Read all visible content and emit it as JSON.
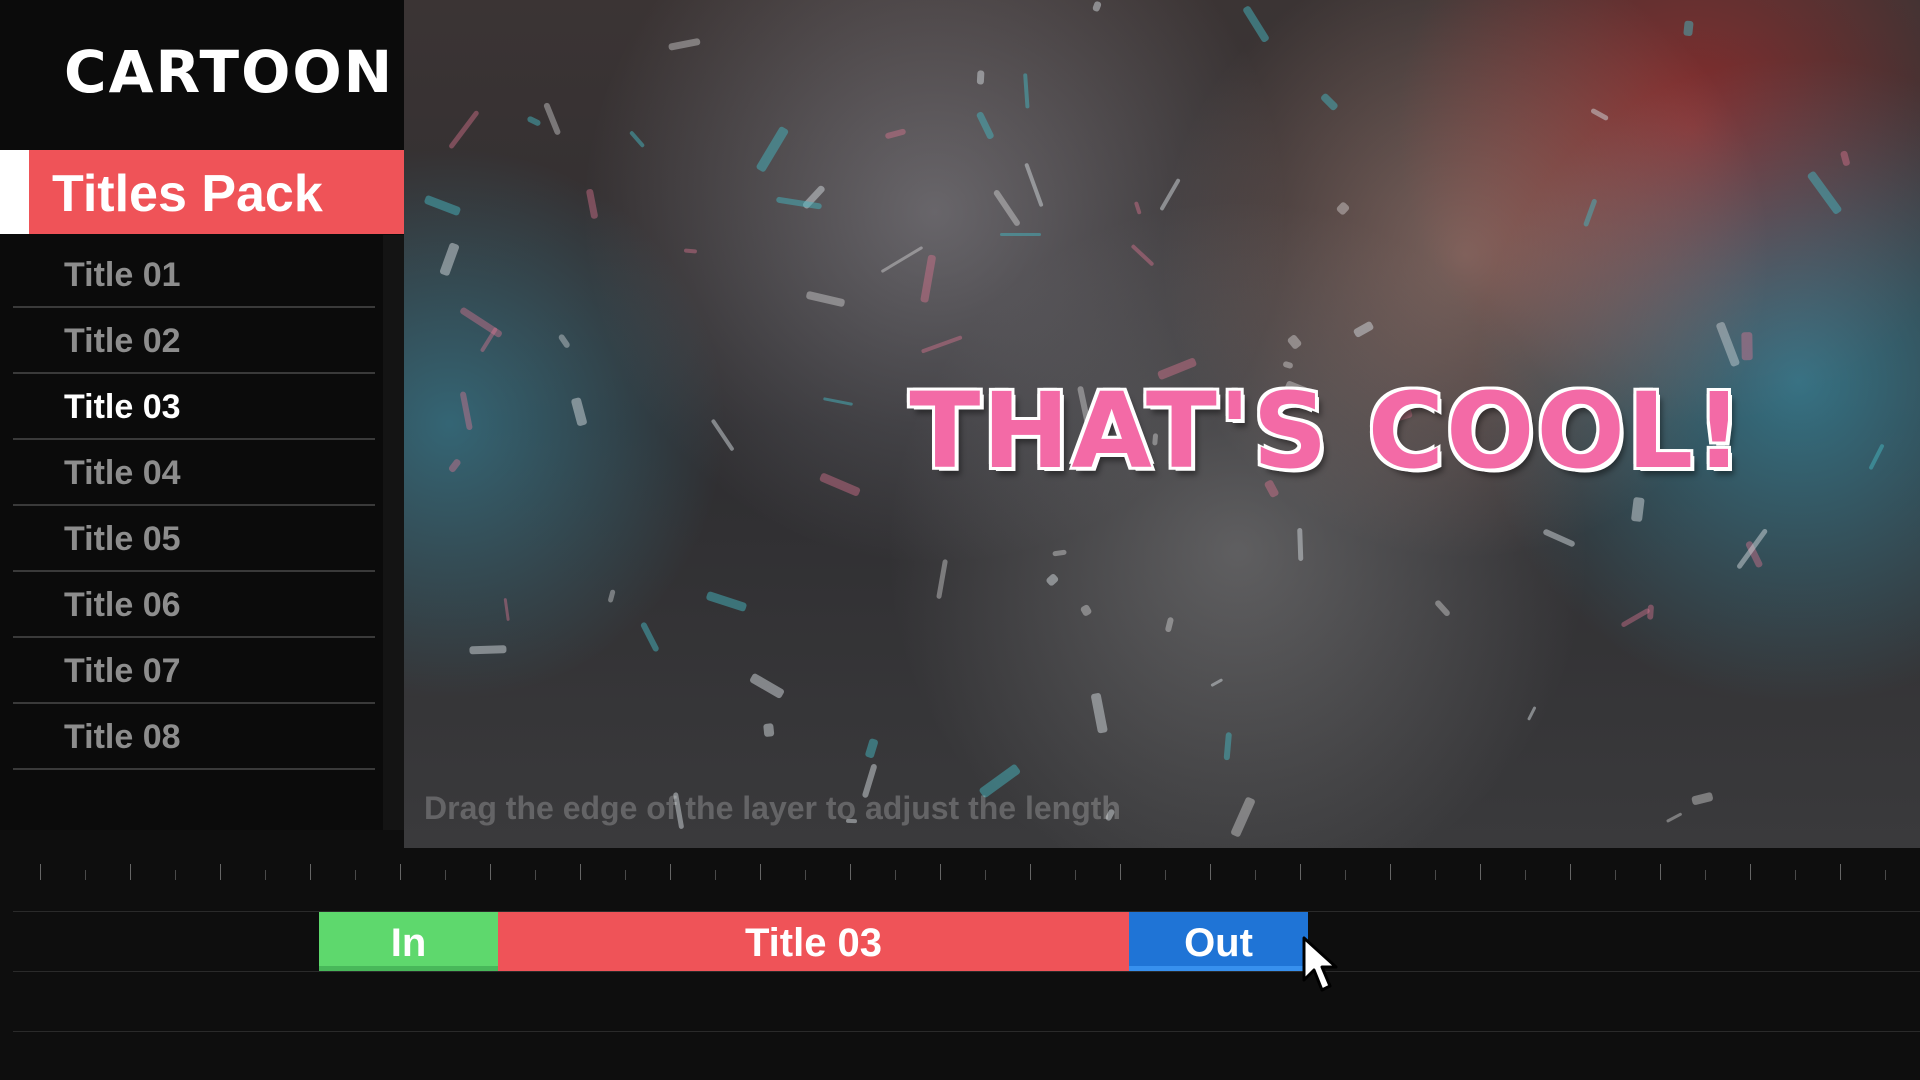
{
  "sidebar": {
    "logo": "CARTOON",
    "pack_label": "Titles Pack",
    "titles": [
      "Title 01",
      "Title 02",
      "Title 03",
      "Title 04",
      "Title 05",
      "Title 06",
      "Title 07",
      "Title 08"
    ],
    "active_index": 2
  },
  "preview": {
    "headline": "THAT'S COOL!",
    "hint": "Drag the edge of the layer to adjust the length"
  },
  "timeline": {
    "in_label": "In",
    "main_label": "Title 03",
    "out_label": "Out"
  },
  "colors": {
    "accent": "#ef5358",
    "in_clip": "#5ed86d",
    "out_clip": "#1f74d6",
    "headline": "#f36aa6"
  }
}
